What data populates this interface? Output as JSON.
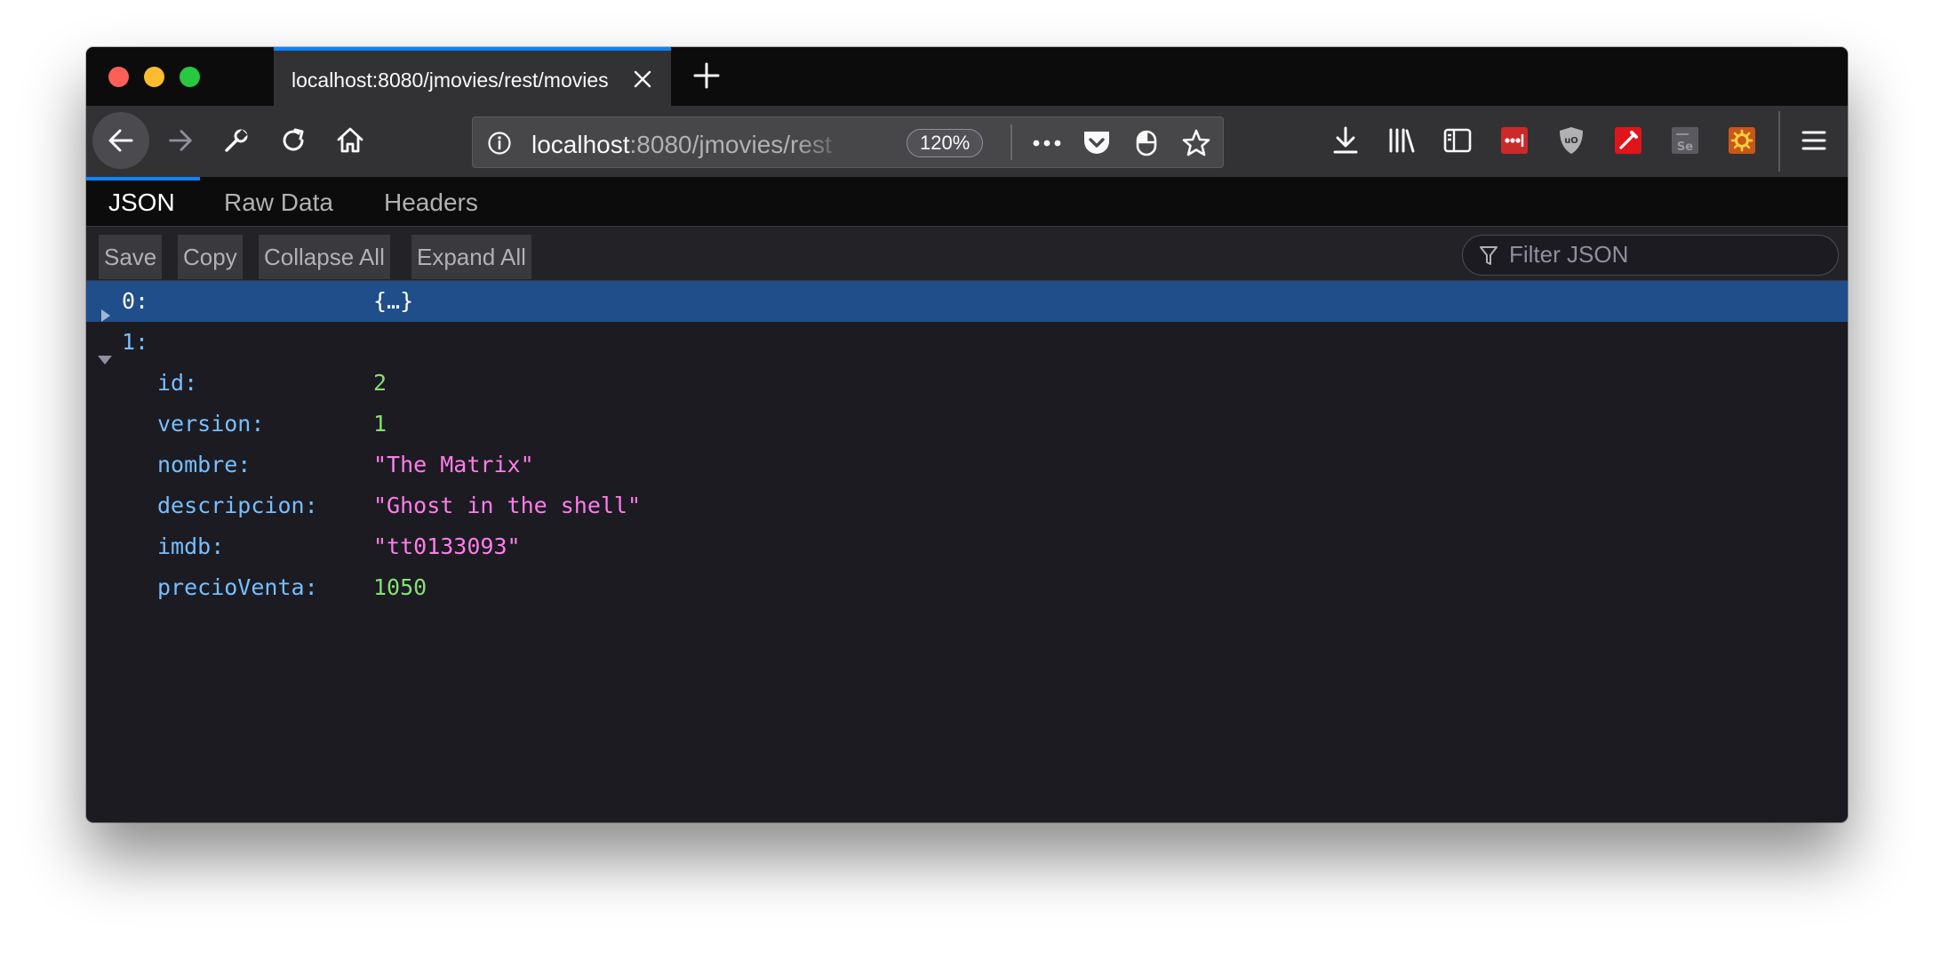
{
  "browser": {
    "tab_title": "localhost:8080/jmovies/rest/movies",
    "url_host": "localhost",
    "url_rest": ":8080/jmovies/rest",
    "zoom": "120%"
  },
  "viewer": {
    "tabs": [
      "JSON",
      "Raw Data",
      "Headers"
    ],
    "buttons": [
      "Save",
      "Copy",
      "Collapse All",
      "Expand All"
    ],
    "filter_placeholder": "Filter JSON"
  },
  "json_tree": {
    "item0": {
      "key": "0:",
      "preview": "{…}"
    },
    "item1": {
      "key": "1:"
    },
    "fields": [
      {
        "key": "id:",
        "value": "2",
        "type": "number"
      },
      {
        "key": "version:",
        "value": "1",
        "type": "number"
      },
      {
        "key": "nombre:",
        "value": "\"The Matrix\"",
        "type": "string"
      },
      {
        "key": "descripcion:",
        "value": "\"Ghost in the shell\"",
        "type": "string"
      },
      {
        "key": "imdb:",
        "value": "\"tt0133093\"",
        "type": "string"
      },
      {
        "key": "precioVenta:",
        "value": "1050",
        "type": "number"
      }
    ]
  },
  "colors": {
    "accent": "#0a84ff",
    "selected_row": "#204e8a",
    "json_key": "#75bfff",
    "json_number": "#86de74",
    "json_string": "#ff7de9"
  }
}
